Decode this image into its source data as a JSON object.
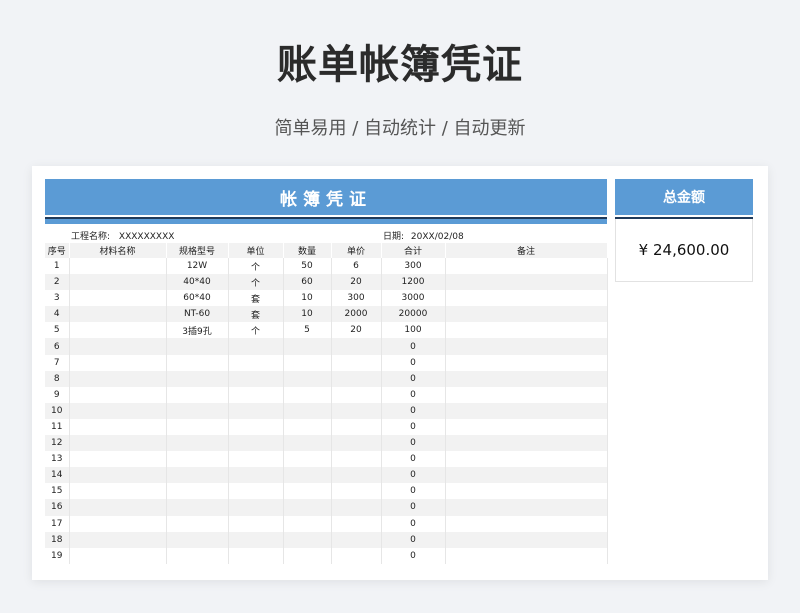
{
  "page": {
    "title": "账单帐簿凭证",
    "subtitle": "简单易用 / 自动统计 / 自动更新"
  },
  "ledger": {
    "header": "帐簿凭证",
    "project_label": "工程名称:",
    "project_value": "XXXXXXXXX",
    "date_label": "日期:",
    "date_value": "20XX/02/08",
    "columns": [
      "序号",
      "材料名称",
      "规格型号",
      "单位",
      "数量",
      "单价",
      "合计",
      "备注"
    ],
    "rows": [
      [
        "1",
        "",
        "12W",
        "个",
        "50",
        "6",
        "300",
        ""
      ],
      [
        "2",
        "",
        "40*40",
        "个",
        "60",
        "20",
        "1200",
        ""
      ],
      [
        "3",
        "",
        "60*40",
        "套",
        "10",
        "300",
        "3000",
        ""
      ],
      [
        "4",
        "",
        "NT-60",
        "套",
        "10",
        "2000",
        "20000",
        ""
      ],
      [
        "5",
        "",
        "3插9孔",
        "个",
        "5",
        "20",
        "100",
        ""
      ],
      [
        "6",
        "",
        "",
        "",
        "",
        "",
        "0",
        ""
      ],
      [
        "7",
        "",
        "",
        "",
        "",
        "",
        "0",
        ""
      ],
      [
        "8",
        "",
        "",
        "",
        "",
        "",
        "0",
        ""
      ],
      [
        "9",
        "",
        "",
        "",
        "",
        "",
        "0",
        ""
      ],
      [
        "10",
        "",
        "",
        "",
        "",
        "",
        "0",
        ""
      ],
      [
        "11",
        "",
        "",
        "",
        "",
        "",
        "0",
        ""
      ],
      [
        "12",
        "",
        "",
        "",
        "",
        "",
        "0",
        ""
      ],
      [
        "13",
        "",
        "",
        "",
        "",
        "",
        "0",
        ""
      ],
      [
        "14",
        "",
        "",
        "",
        "",
        "",
        "0",
        ""
      ],
      [
        "15",
        "",
        "",
        "",
        "",
        "",
        "0",
        ""
      ],
      [
        "16",
        "",
        "",
        "",
        "",
        "",
        "0",
        ""
      ],
      [
        "17",
        "",
        "",
        "",
        "",
        "",
        "0",
        ""
      ],
      [
        "18",
        "",
        "",
        "",
        "",
        "",
        "0",
        ""
      ],
      [
        "19",
        "",
        "",
        "",
        "",
        "",
        "0",
        ""
      ]
    ]
  },
  "total": {
    "header": "总金额",
    "amount": "¥ 24,600.00"
  },
  "colors": {
    "accent": "#5b9bd5",
    "rule": "#1f3a5a",
    "background": "#f1f3f6",
    "row_alt": "#f2f2f2"
  }
}
